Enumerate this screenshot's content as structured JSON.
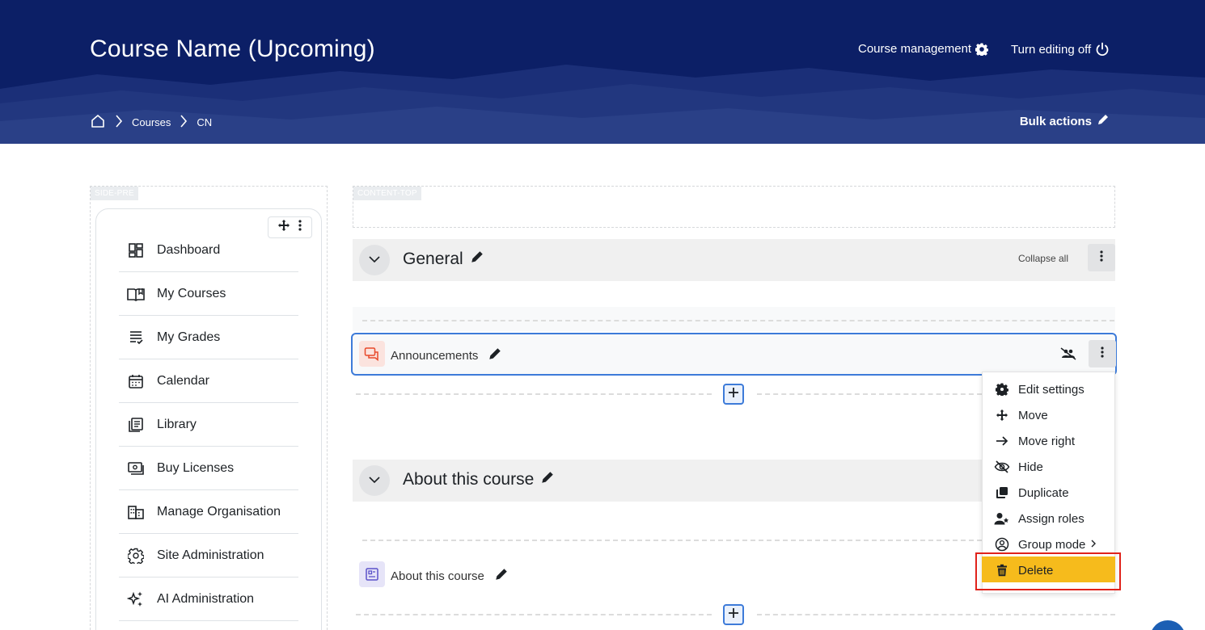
{
  "header": {
    "course_title": "Course Name (Upcoming)",
    "course_management_label": "Course management",
    "editing_toggle_label": "Turn editing off",
    "bulk_actions_label": "Bulk actions",
    "breadcrumb": [
      "Courses",
      "CN"
    ],
    "bg_color": "#0c1f66"
  },
  "regions": {
    "side_pre": "SIDE-PRE",
    "content_top": "CONTENT-TOP"
  },
  "sidebar": {
    "items": [
      {
        "label": "Dashboard",
        "icon": "dashboard-icon"
      },
      {
        "label": "My Courses",
        "icon": "book-open-icon"
      },
      {
        "label": "My Grades",
        "icon": "grades-list-icon"
      },
      {
        "label": "Calendar",
        "icon": "calendar-icon"
      },
      {
        "label": "Library",
        "icon": "library-icon"
      },
      {
        "label": "Buy Licenses",
        "icon": "licenses-icon"
      },
      {
        "label": "Manage Organisation",
        "icon": "organisation-icon"
      },
      {
        "label": "Site Administration",
        "icon": "gear-icon"
      },
      {
        "label": "AI Administration",
        "icon": "sparkles-icon"
      }
    ]
  },
  "sections": [
    {
      "title": "General",
      "collapse_all_label": "Collapse all"
    },
    {
      "title": "About this course"
    }
  ],
  "activities": [
    {
      "name": "Announcements",
      "icon": "forum-icon",
      "icon_color": "#e8492a"
    },
    {
      "name": "About this course",
      "icon": "page-icon",
      "icon_color": "#5b52c9"
    }
  ],
  "menu": {
    "items": [
      {
        "label": "Edit settings",
        "icon": "gear-icon"
      },
      {
        "label": "Move",
        "icon": "move-arrows-icon"
      },
      {
        "label": "Move right",
        "icon": "arrow-right-icon"
      },
      {
        "label": "Hide",
        "icon": "eye-slash-icon"
      },
      {
        "label": "Duplicate",
        "icon": "copy-icon"
      },
      {
        "label": "Assign roles",
        "icon": "user-roles-icon"
      },
      {
        "label": "Group mode",
        "icon": "group-circle-icon"
      },
      {
        "label": "Delete",
        "icon": "trash-icon"
      }
    ],
    "highlight_color": "#f6bb1c",
    "annotation_color": "#e0221b"
  },
  "accent_color": "#3d7bd9"
}
